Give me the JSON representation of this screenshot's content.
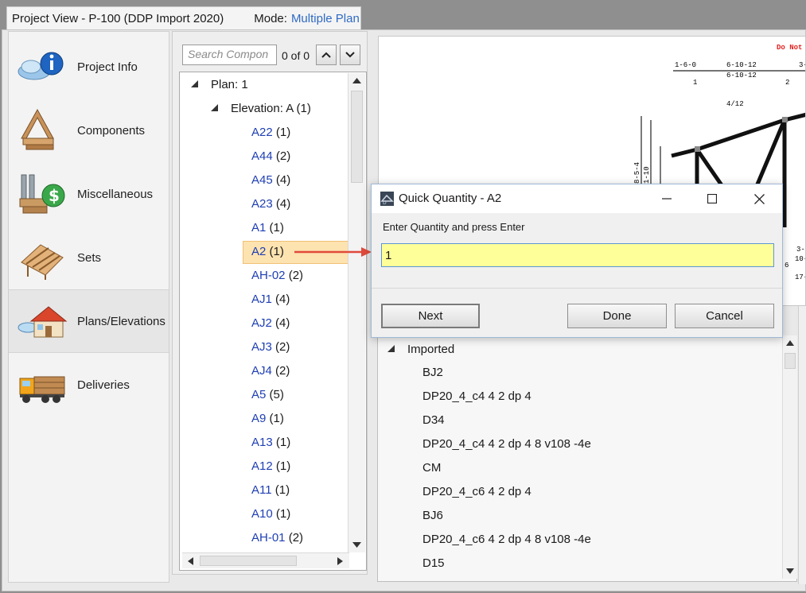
{
  "window": {
    "title": "Project View - P-100 (DDP Import 2020)",
    "mode_label": "Mode:",
    "mode_value": "Multiple Plan"
  },
  "nav": {
    "items": [
      {
        "label": "Project Info",
        "icon": "project-info-icon"
      },
      {
        "label": "Components",
        "icon": "components-icon"
      },
      {
        "label": "Miscellaneous",
        "icon": "miscellaneous-icon"
      },
      {
        "label": "Sets",
        "icon": "sets-icon"
      },
      {
        "label": "Plans/Elevations",
        "icon": "plans-elevations-icon",
        "active": true
      },
      {
        "label": "Deliveries",
        "icon": "deliveries-icon"
      }
    ]
  },
  "tree": {
    "search_placeholder": "Search Compon",
    "search_count": "0 of 0",
    "plan_label": "Plan:  1",
    "elevation_label": "Elevation:  A (1)",
    "items": [
      {
        "name": "A22",
        "count": "(1)"
      },
      {
        "name": "A44",
        "count": "(2)"
      },
      {
        "name": "A45",
        "count": "(4)"
      },
      {
        "name": "A23",
        "count": "(4)"
      },
      {
        "name": "A1",
        "count": "(1)"
      },
      {
        "name": "A2",
        "count": "(1)",
        "selected": true
      },
      {
        "name": "AH-02",
        "count": "(2)"
      },
      {
        "name": "AJ1",
        "count": "(4)"
      },
      {
        "name": "AJ2",
        "count": "(4)"
      },
      {
        "name": "AJ3",
        "count": "(2)"
      },
      {
        "name": "AJ4",
        "count": "(2)"
      },
      {
        "name": "A5",
        "count": "(5)"
      },
      {
        "name": "A9",
        "count": "(1)"
      },
      {
        "name": "A13",
        "count": "(1)"
      },
      {
        "name": "A12",
        "count": "(1)"
      },
      {
        "name": "A11",
        "count": "(1)"
      },
      {
        "name": "A10",
        "count": "(1)"
      },
      {
        "name": "AH-01",
        "count": "(2)"
      }
    ]
  },
  "drawing": {
    "warning": "Do  Not",
    "dim_top_left": "1-6-0",
    "dim_top_mid_a": "6-10-12",
    "dim_top_mid_b": "6-10-12",
    "dim_top_right": "3-",
    "node_1": "1",
    "node_2": "2",
    "pitch": "4/12",
    "vert_dim_a": "8-5-4",
    "vert_dim_b": "1-10",
    "bottom_dim_a": "3-",
    "bottom_dim_b": "10-",
    "bottom_node": "6",
    "bottom_dim_c": "17-"
  },
  "imported": {
    "header": "Imported",
    "items": [
      "BJ2",
      "DP20_4_c4 4 2 dp 4",
      "D34",
      "DP20_4_c4 4 2 dp 4 8 v108 -4e",
      "CM",
      "DP20_4_c6 4 2 dp 4",
      "BJ6",
      "DP20_4_c6 4 2 dp 4 8 v108 -4e",
      "D15"
    ]
  },
  "dialog": {
    "title": "Quick Quantity - A2",
    "prompt": "Enter Quantity and press Enter",
    "value": "1",
    "next_label": "Next",
    "done_label": "Done",
    "cancel_label": "Cancel"
  },
  "colors": {
    "link": "#1f3fb3",
    "mode": "#2f6ac4",
    "selection": "#fde3b0",
    "input_bg": "#ffff99",
    "warning": "#e0221e",
    "arrow": "#e04a3a"
  }
}
